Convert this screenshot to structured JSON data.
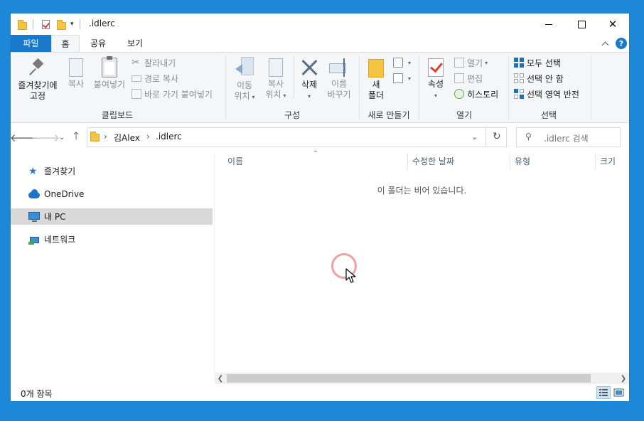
{
  "window": {
    "title": ".idlerc"
  },
  "title_controls": {
    "close_glyph": "✕"
  },
  "ribbon_tabs": [
    {
      "label": "파일"
    },
    {
      "label": "홈"
    },
    {
      "label": "공유"
    },
    {
      "label": "보기"
    }
  ],
  "help_glyph": "?",
  "clipboard": {
    "pin_line1": "즐겨찾기에",
    "pin_line2": "고정",
    "copy": "복사",
    "paste": "붙여넣기",
    "cut": "잘라내기",
    "copy_path": "경로 복사",
    "paste_shortcut": "바로 가기 붙여넣기",
    "group_label": "클립보드"
  },
  "organize": {
    "move_line1": "이동",
    "move_line2": "위치",
    "copyto_line1": "복사",
    "copyto_line2": "위치",
    "delete": "삭제",
    "rename_line1": "이름",
    "rename_line2": "바꾸기",
    "group_label": "구성"
  },
  "new": {
    "newfolder_line1": "새",
    "newfolder_line2": "폴더",
    "group_label": "새로 만들기"
  },
  "open": {
    "properties": "속성",
    "open": "열기",
    "edit": "편집",
    "history": "히스토리",
    "group_label": "열기"
  },
  "select": {
    "select_all": "모두 선택",
    "select_none": "선택 안 함",
    "invert": "선택 영역 반전",
    "group_label": "선택"
  },
  "address": {
    "segments": [
      "김Alex",
      ".idlerc"
    ],
    "refresh_glyph": "↻"
  },
  "search": {
    "placeholder": ".idlerc 검색"
  },
  "nav_pane": {
    "items": [
      {
        "label": "즐겨찾기"
      },
      {
        "label": "OneDrive"
      },
      {
        "label": "내 PC"
      },
      {
        "label": "네트워크"
      }
    ]
  },
  "columns": [
    "이름",
    "수정한 날짜",
    "유형",
    "크기"
  ],
  "empty_message": "이 폴더는 비어 있습니다.",
  "status": {
    "item_count": "0개 항목"
  },
  "colors": {
    "desktop": "#1e88d8",
    "file_tab": "#1979ca",
    "selected_nav": "#d9d9d9"
  }
}
